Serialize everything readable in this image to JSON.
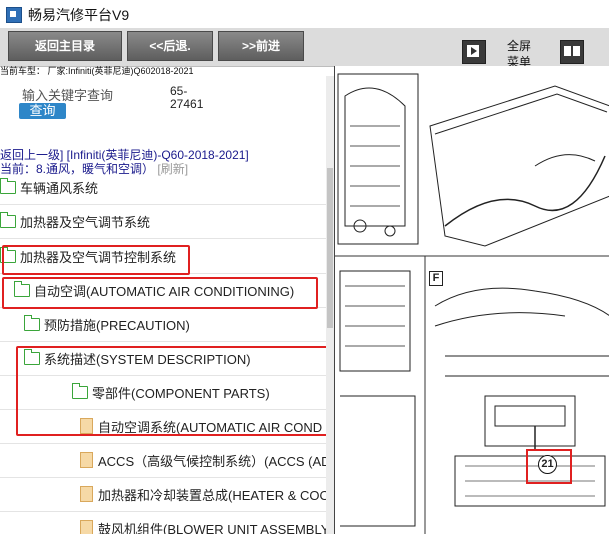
{
  "window": {
    "title": "畅易汽修平台V9"
  },
  "toolbar": {
    "back_home": "返回主目录",
    "back": "<<后退.",
    "forward": ">>前进",
    "fullscreen_line1": "全屏",
    "fullscreen_line2": "菜单"
  },
  "car": {
    "info": "当前车型： 厂家:Infiniti(英菲尼迪)Q602018-2021"
  },
  "search": {
    "label": "输入关键字查询",
    "button": "查询",
    "code_line1": "65-",
    "code_line2": "27461"
  },
  "breadcrumb": {
    "up": "返回上一级]",
    "path": " [Infiniti(英菲尼迪)-Q60-2018-2021]",
    "current": "当前：8.通风，暖气和空调）",
    "refresh": "[刷新]"
  },
  "tree": [
    {
      "label": "车辆通风系统",
      "type": "folder"
    },
    {
      "label": "加热器及空气调节系统",
      "type": "folder"
    },
    {
      "label": "加热器及空气调节控制系统",
      "type": "folder"
    },
    {
      "label": "自动空调(AUTOMATIC AIR CONDITIONING)",
      "type": "folder"
    },
    {
      "label": "预防措施(PRECAUTION)",
      "type": "folder"
    },
    {
      "label": "系统描述(SYSTEM DESCRIPTION)",
      "type": "folder"
    },
    {
      "label": "零部件(COMPONENT PARTS)",
      "type": "folder"
    },
    {
      "label": "自动空调系统(AUTOMATIC AIR COND",
      "type": "doc"
    },
    {
      "label": "ACCS（高级气候控制系统）(ACCS (AD",
      "type": "doc"
    },
    {
      "label": "加热器和冷却装置总成(HEATER & COO",
      "type": "doc"
    },
    {
      "label": "鼓风机组件(BLOWER UNIT ASSEMBLY",
      "type": "doc"
    }
  ],
  "diagram": {
    "section_label": "F",
    "callout": "21"
  },
  "colors": {
    "highlight": "#e02020",
    "folder": "#3aa53a",
    "button": "#2e86c8"
  }
}
